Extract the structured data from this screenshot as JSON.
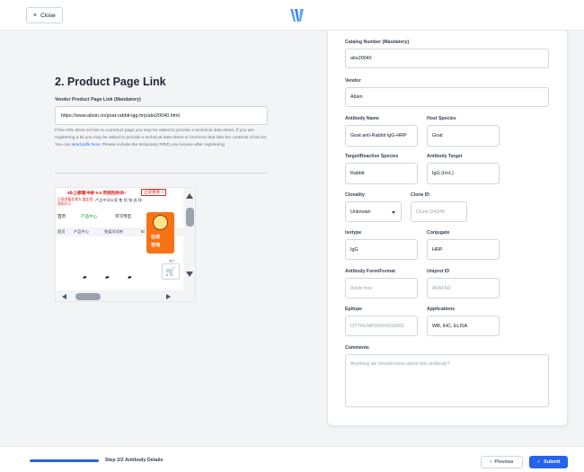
{
  "header": {
    "close_label": "Close",
    "close_icon": "×"
  },
  "left": {
    "section_title": "2. Product Page Link",
    "vendor_label": "Vendor Product Page Link (Mandatory)",
    "vendor_url": "https://www.absin.cn/goat-rabbit-igg-hrp/abs20040.html",
    "help_part1": "If the URL does not link to a product page you may be asked to provide a technical data sheet. If you are registering a kit you may be asked to provide a technical data sheet or brochure that lists the contents of the kit. You can ",
    "help_link": "send pdfs here",
    "help_part2": ". Please include the temporary RRID you receive after registering.",
    "preview": {
      "banner_red": "5₺上標惠冲峡 9.9 用期刮秒杀!",
      "banner_btn": "立即重看 >",
      "tiny_text": "正规多备及频方 盖此相类知开示",
      "search_hint": "产品中间义获 售 您 钱 选 择",
      "nav": [
        "首页",
        "产品中心",
        "学习专区"
      ],
      "crumbs": [
        "首页",
        "产品中心",
        "免疫学试剂",
        "Bi"
      ],
      "mascot_line1": "在线",
      "mascot_line2": "咨询",
      "igg": "IgG-",
      "cart_icon": "🛒"
    }
  },
  "form": {
    "catalog_label": "Catalog Number (Mandatory)",
    "catalog_value": "abs20040",
    "vendor_label": "Vendor",
    "vendor_value": "Absin",
    "antibody_name_label": "Antibody Name",
    "antibody_name_value": "Goat anti-Rabbit IgG-HRP",
    "host_species_label": "Host Species",
    "host_species_value": "Goat",
    "target_species_label": "Target/Reactive Species",
    "target_species_value": "Rabbit",
    "antibody_target_label": "Antibody Target",
    "antibody_target_value": "IgG (H+L)",
    "clonality_label": "Clonality",
    "clonality_value": "Unknown",
    "clone_id_label": "Clone ID",
    "clone_id_placeholder": "Clone D4S40",
    "isotype_label": "Isotype",
    "isotype_value": "IgG",
    "conjugate_label": "Conjugate",
    "conjugate_value": "HRP",
    "format_label": "Antibody Form/Format",
    "format_placeholder": "Azide free",
    "uniprot_label": "Uniprot ID",
    "uniprot_placeholder": "A6NFN3",
    "epitope_label": "Epitope",
    "epitope_placeholder": "OTTHUMP00000018992",
    "applications_label": "Applications",
    "applications_value": "WB, IHC, ELISA",
    "comments_label": "Comments",
    "comments_placeholder": "Anything we should know about this antibody?"
  },
  "footer": {
    "step_label": "Step 2/2 Antibody Details",
    "progress_fraction": 1.0,
    "previous_label": "Previous",
    "previous_icon": "‹",
    "submit_label": "Submit",
    "submit_icon": "✓"
  },
  "colors": {
    "primary": "#2563eb",
    "panel_bg": "#f3f4f6"
  }
}
